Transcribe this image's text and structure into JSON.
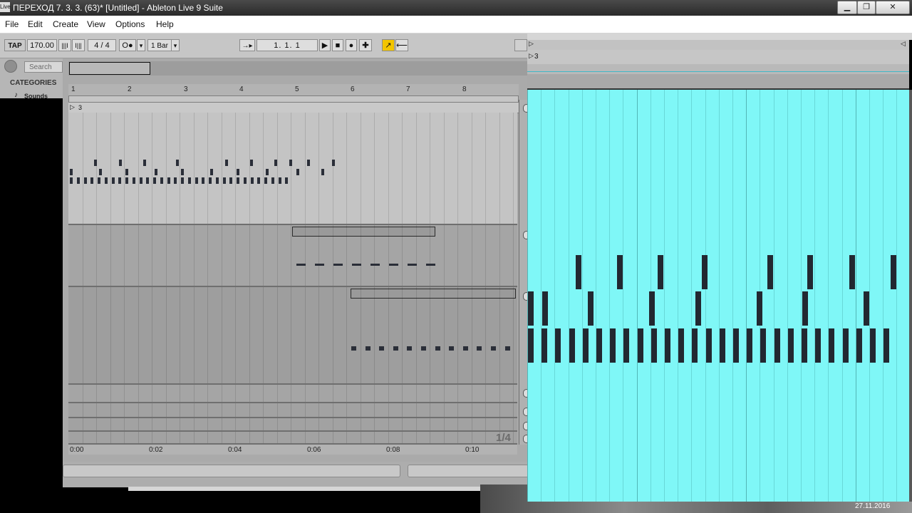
{
  "window": {
    "app_icon_label": "Live",
    "title": "ПЕРЕХОД 7. 3. 3. (63)*  [Untitled] - Ableton Live 9 Suite",
    "minimize": "▁",
    "maximize": "❐",
    "close": "✕"
  },
  "menu": [
    "File",
    "Edit",
    "Create",
    "View",
    "Options",
    "Help"
  ],
  "toolbar": {
    "tap": "TAP",
    "tempo": "170.00",
    "nudge_down": "|||I",
    "nudge_up": "I|||",
    "signature_num": "4",
    "signature_sep": "/",
    "signature_den": "4",
    "metronome": "O●",
    "metronome_arrow": "▾",
    "quantize": "1 Bar",
    "quantize_arrow": "▾",
    "follow_icon": "→▸",
    "position": "1.   1.   1",
    "play": "▶",
    "stop": "■",
    "record": "●",
    "add": "✚",
    "automation_icon": "↗",
    "back_icon": "⟵"
  },
  "browser": {
    "search_placeholder": "Search",
    "categories_label": "CATEGORIES",
    "sounds_label": "Sounds"
  },
  "arrangement": {
    "bar_numbers": [
      "1",
      "2",
      "3",
      "4",
      "5",
      "6",
      "7",
      "8"
    ],
    "marker_label": "3",
    "time_labels": [
      "0:00",
      "0:02",
      "0:04",
      "0:06",
      "0:08",
      "0:10"
    ],
    "zoom_label": "1/4"
  },
  "zoom_view": {
    "marker_label": "3"
  },
  "taskbar": {
    "date": "27.11.2016"
  }
}
